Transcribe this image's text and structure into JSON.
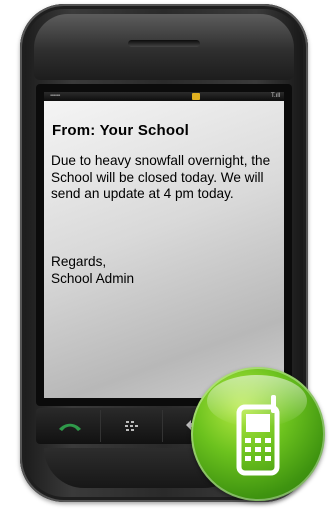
{
  "message": {
    "from_line": "From: Your School",
    "body": "Due to heavy snowfall overnight, the School will be closed today. We will send an update at 4 pm today.",
    "signature": "Regards,\nSchool Admin"
  },
  "status_bar": {
    "left_text": "▪▪▪▪▪▪",
    "signal_text": "T.ıll"
  },
  "icons": {
    "call_key": "phone-call-icon",
    "menu_key": "blackberry-menu-icon",
    "back_key": "back-arrow-icon",
    "badge": "mobile-phone-icon"
  },
  "colors": {
    "badge_green": "#5cb319",
    "phone_body": "#2a2a2a",
    "call_green": "#2f9a4a"
  }
}
